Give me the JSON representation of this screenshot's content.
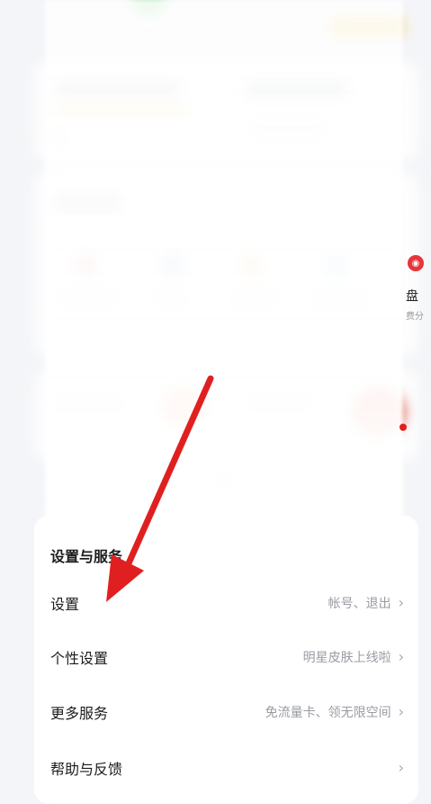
{
  "settings_section": {
    "title": "设置与服务",
    "rows": [
      {
        "label": "设置",
        "sub": "帐号、退出"
      },
      {
        "label": "个性设置",
        "sub": "明星皮肤上线啦"
      },
      {
        "label": "更多服务",
        "sub": "免流量卡、领无限空间"
      },
      {
        "label": "帮助与反馈",
        "sub": ""
      }
    ]
  },
  "peek": {
    "label": "盘",
    "sub": "费分"
  },
  "icons": {
    "chevron": "chevron-right-icon",
    "peek_icon": "red-badge-icon"
  },
  "colors": {
    "annotation_arrow": "#e02020",
    "background": "#f4f5f8",
    "card": "#ffffff",
    "secondary_text": "#9a9ca3"
  }
}
